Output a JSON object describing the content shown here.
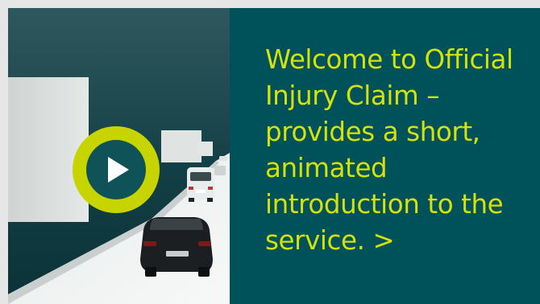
{
  "video": {
    "play_icon": "play-icon",
    "thumbnail": "animated-road-with-cars"
  },
  "promo": {
    "text": "Welcome to Official Injury Claim – provides a short, animated introduction to the service. >"
  },
  "colors": {
    "panel_background": "#00525a",
    "accent": "#c8d400",
    "text": "#d4e20a",
    "page_background": "#e6e6e6"
  }
}
